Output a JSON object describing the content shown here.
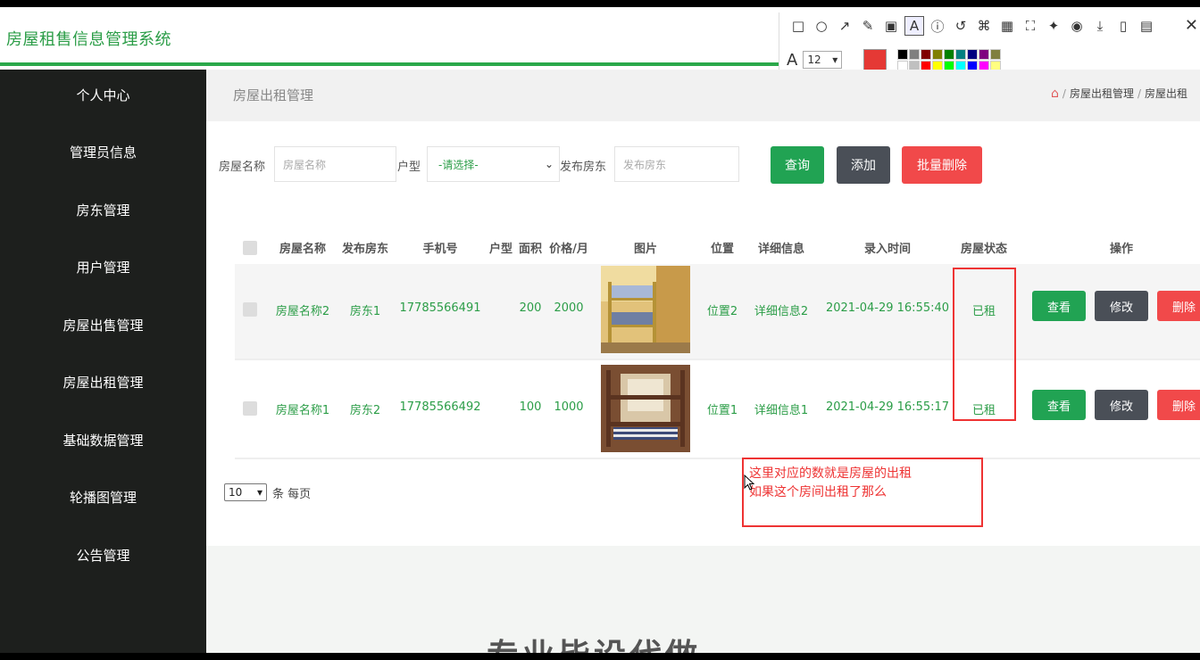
{
  "app": {
    "title": "房屋租售信息管理系统"
  },
  "snip_toolbar": {
    "tools": [
      "rect-icon",
      "ellipse-icon",
      "arrow-icon",
      "pen-icon",
      "mosaic-icon",
      "text-icon",
      "number-icon",
      "undo-icon",
      "pin-icon",
      "ocr-icon",
      "scan-icon",
      "sticker-icon",
      "record-icon",
      "download-icon",
      "phone-icon",
      "save-icon"
    ],
    "font_size": "12",
    "current_color": "#e53935",
    "palette": [
      "#000000",
      "#808080",
      "#800000",
      "#808000",
      "#008000",
      "#008080",
      "#000080",
      "#800080",
      "#808040",
      "#ffffff",
      "#c0c0c0",
      "#ff0000",
      "#ffff00",
      "#00ff00",
      "#00ffff",
      "#0000ff",
      "#ff00ff",
      "#ffff80"
    ],
    "close_label": "✕"
  },
  "sidebar": {
    "items": [
      "个人中心",
      "管理员信息",
      "房东管理",
      "用户管理",
      "房屋出售管理",
      "房屋出租管理",
      "基础数据管理",
      "轮播图管理",
      "公告管理"
    ]
  },
  "breadcrumb": {
    "page_title": "房屋出租管理",
    "items": [
      "房屋出租管理",
      "房屋出租"
    ]
  },
  "search": {
    "name_label": "房屋名称",
    "name_placeholder": "房屋名称",
    "type_label": "户型",
    "type_selected": "-请选择-",
    "landlord_label": "发布房东",
    "landlord_placeholder": "发布房东",
    "query_button": "查询",
    "add_button": "添加",
    "batch_delete_button": "批量删除"
  },
  "table": {
    "columns": [
      "房屋名称",
      "发布房东",
      "手机号",
      "户型",
      "面积",
      "价格/月",
      "图片",
      "位置",
      "详细信息",
      "录入时间",
      "房屋状态",
      "操作"
    ],
    "rows": [
      {
        "name": "房屋名称2",
        "landlord": "房东1",
        "phone": "17785566491",
        "type": "",
        "area": "200",
        "price": "2000",
        "location": "位置2",
        "detail": "详细信息2",
        "time": "2021-04-29 16:55:40",
        "status": "已租"
      },
      {
        "name": "房屋名称1",
        "landlord": "房东2",
        "phone": "17785566492",
        "type": "",
        "area": "100",
        "price": "1000",
        "location": "位置1",
        "detail": "详细信息1",
        "time": "2021-04-29 16:55:17",
        "status": "已租"
      }
    ],
    "actions": {
      "view": "查看",
      "edit": "修改",
      "delete": "删除"
    }
  },
  "pager": {
    "page_size": "10",
    "per_page_label": "条 每页"
  },
  "annotation": {
    "line1": "这里对应的数就是房屋的出租",
    "line2": "如果这个房间出租了那么"
  },
  "footer_banner": {
    "text": "专业毕设代做"
  },
  "colors": {
    "brand_green": "#2b9d47",
    "sidebar_bg": "#1d1f1d",
    "danger": "#f1494a",
    "annotation_red": "#e33333"
  }
}
